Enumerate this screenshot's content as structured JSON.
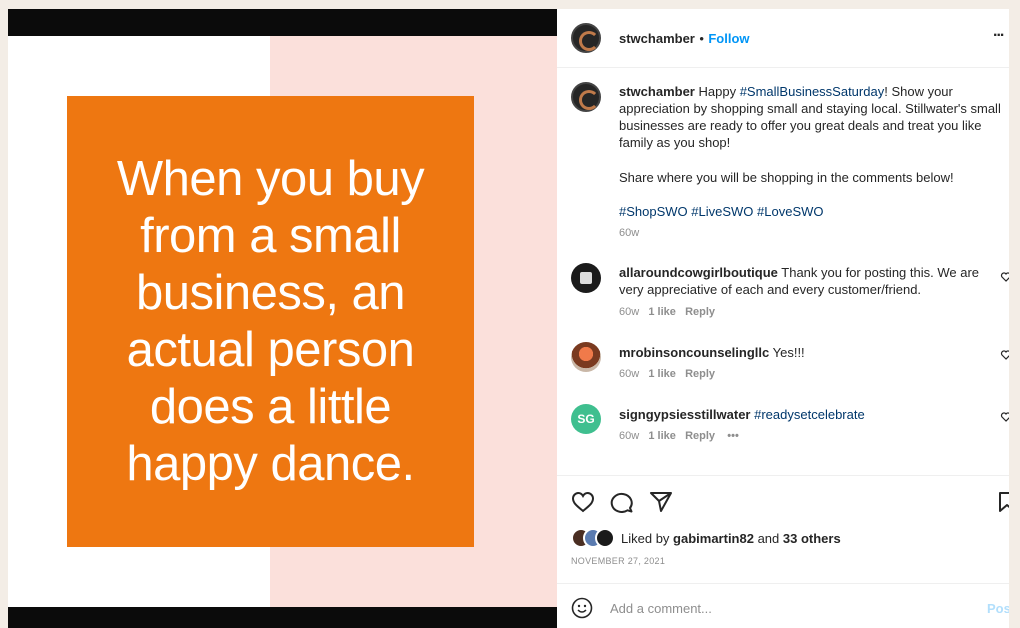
{
  "image": {
    "quote": "When you buy from a small business, an actual person does a little happy dance."
  },
  "header": {
    "username": "stwchamber",
    "separator": "•",
    "follow_label": "Follow",
    "more_label": "..."
  },
  "caption": {
    "username": "stwchamber",
    "text_1": " Happy ",
    "tag_1": "#SmallBusinessSaturday",
    "text_2": "! Show your appreciation by shopping small and staying local. Stillwater's small businesses are ready to offer you great deals and treat you like family as you shop!",
    "text_3": "Share where you will be shopping in the comments below!",
    "hashtags": [
      "#ShopSWO",
      "#LiveSWO",
      "#LoveSWO"
    ],
    "age": "60w"
  },
  "comments": [
    {
      "username": "allaroundcowgirlboutique",
      "text": " Thank you for posting this. We are very appreciative of each and every customer/friend.",
      "age": "60w",
      "likes": "1 like",
      "reply": "Reply"
    },
    {
      "username": "mrobinsoncounselingllc",
      "text": " Yes!!!",
      "age": "60w",
      "likes": "1 like",
      "reply": "Reply"
    },
    {
      "username": "signgypsiesstillwater",
      "text": "#readysetcelebrate",
      "age": "60w",
      "likes": "1 like",
      "reply": "Reply",
      "more": "•••"
    }
  ],
  "comment_avatar_sign_text": "SG",
  "likes": {
    "prefix": "Liked by ",
    "user": "gabimartin82",
    "joiner": " and ",
    "others": "33 others"
  },
  "date": "NOVEMBER 27, 2021",
  "add_comment": {
    "placeholder": "Add a comment...",
    "post_label": "Pos"
  },
  "icons": [
    "heart-icon",
    "comment-icon",
    "share-icon",
    "bookmark-icon",
    "emoji-icon",
    "more-icon"
  ],
  "colors": {
    "orange": "#ee7711",
    "pink": "#fbe0db",
    "follow_blue": "#0095f6",
    "link_blue": "#00376b"
  }
}
